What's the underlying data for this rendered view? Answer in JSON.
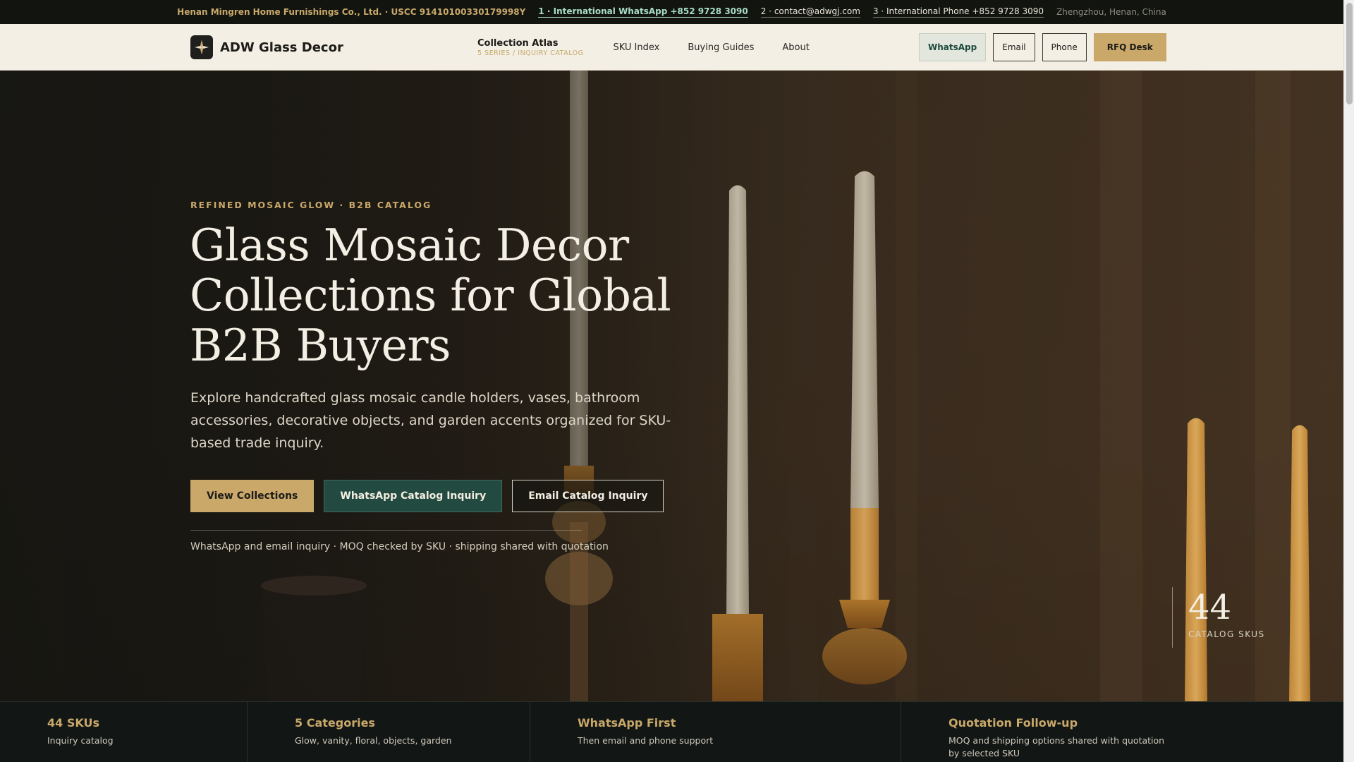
{
  "topbar": {
    "company": "Henan Mingren Home Furnishings Co., Ltd. · USCC 91410100330179998Y",
    "whatsapp": "1 · International WhatsApp +852 9728 3090",
    "email": "2 · contact@adwgj.com",
    "phone": "3 · International Phone +852 9728 3090",
    "location": "Zhengzhou, Henan, China"
  },
  "brand": {
    "name": "ADW Glass Decor",
    "logo_icon": "compass-star-icon"
  },
  "nav": {
    "atlas_title": "Collection Atlas",
    "atlas_sub": "5 SERIES / INQUIRY CATALOG",
    "items": [
      "SKU Index",
      "Buying Guides",
      "About"
    ]
  },
  "header_actions": {
    "whatsapp": "WhatsApp",
    "email": "Email",
    "phone": "Phone",
    "rfq": "RFQ Desk"
  },
  "hero": {
    "eyebrow": "REFINED MOSAIC GLOW · B2B CATALOG",
    "headline": "Glass Mosaic Decor Collections for Global B2B Buyers",
    "lede": "Explore handcrafted glass mosaic candle holders, vases, bathroom accessories, decorative objects, and garden accents organized for SKU-based trade inquiry.",
    "cta": {
      "view": "View Collections",
      "whatsapp": "WhatsApp Catalog Inquiry",
      "email": "Email Catalog Inquiry"
    },
    "note": "WhatsApp and email inquiry · MOQ checked by SKU · shipping shared with quotation",
    "stat_number": "44",
    "stat_label": "CATALOG SKUS"
  },
  "features": [
    {
      "title": "44 SKUs",
      "desc": "Inquiry catalog"
    },
    {
      "title": "5 Categories",
      "desc": "Glow, vanity, floral, objects, garden"
    },
    {
      "title": "WhatsApp First",
      "desc": "Then email and phone support"
    },
    {
      "title": "Quotation Follow-up",
      "desc": "MOQ and shipping options shared with quotation by selected SKU"
    }
  ],
  "colors": {
    "gold": "#c9a86a",
    "green": "#234a40",
    "cream": "#f3efe4",
    "dark": "#14130f"
  }
}
